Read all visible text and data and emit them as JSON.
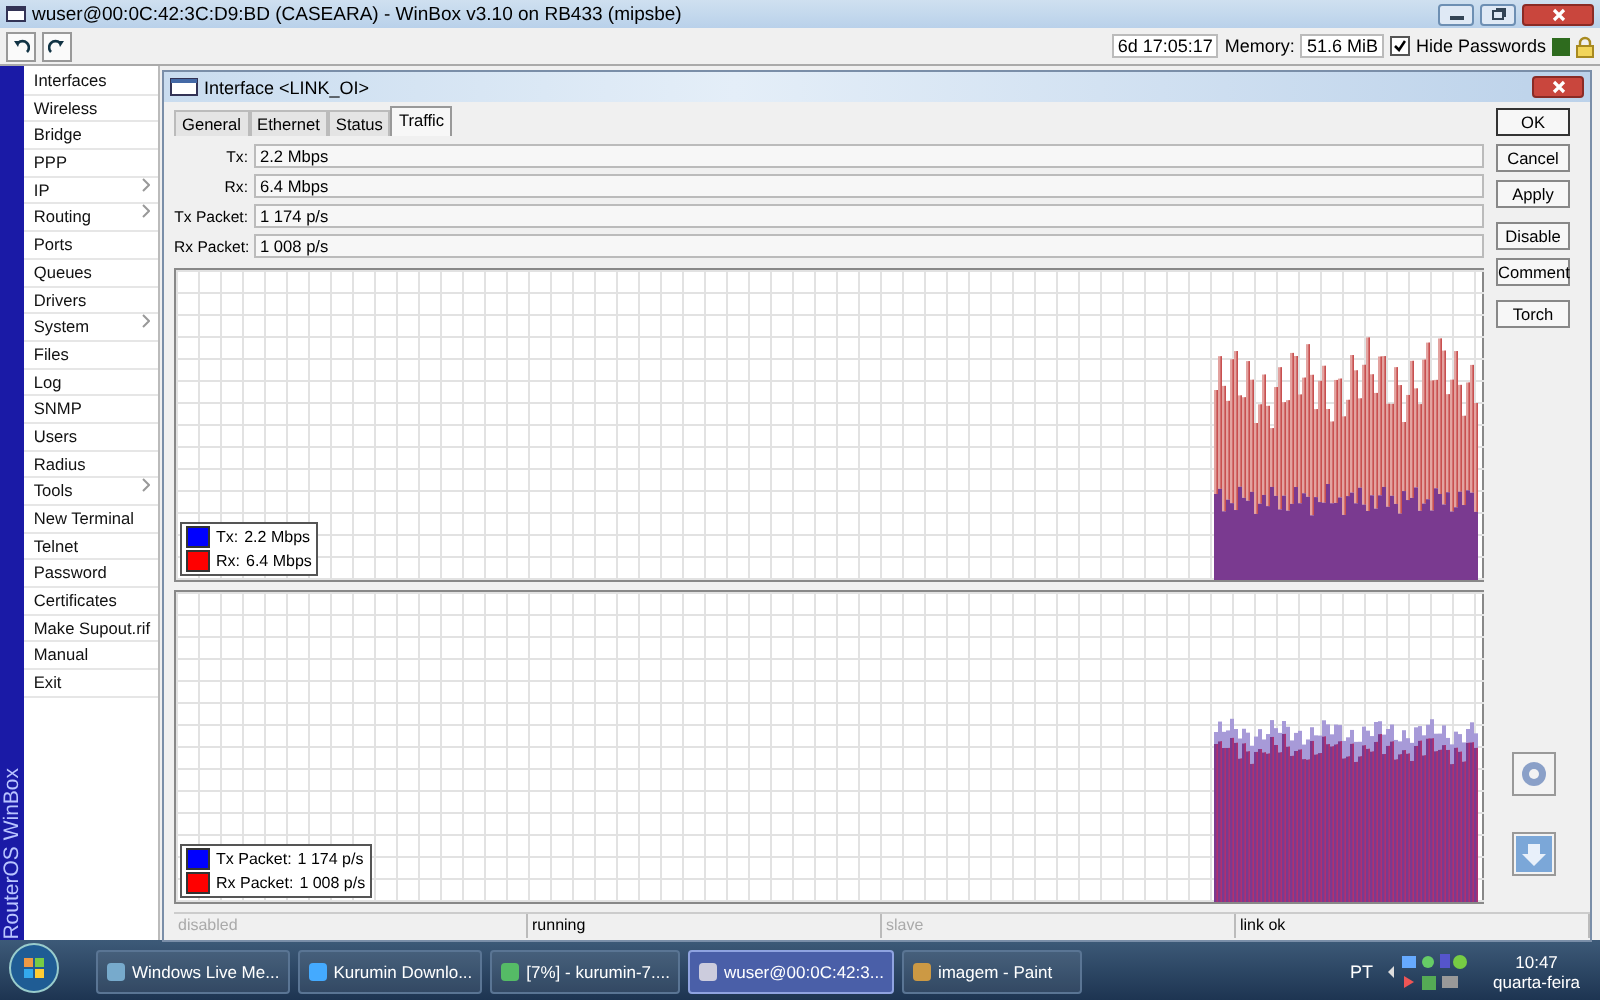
{
  "window": {
    "title": "wuser@00:0C:42:3C:D9:BD (CASEARA) - WinBox v3.10 on RB433 (mipsbe)"
  },
  "toolbar": {
    "uptime": "6d 17:05:17",
    "memory_label": "Memory:",
    "memory": "51.6 MiB",
    "hide_passwords": {
      "label": "Hide Passwords",
      "checked": true
    }
  },
  "sidebar": {
    "brand": "RouterOS WinBox",
    "items": [
      {
        "label": "Interfaces",
        "submenu": false
      },
      {
        "label": "Wireless",
        "submenu": false
      },
      {
        "label": "Bridge",
        "submenu": false
      },
      {
        "label": "PPP",
        "submenu": false
      },
      {
        "label": "IP",
        "submenu": true
      },
      {
        "label": "Routing",
        "submenu": true
      },
      {
        "label": "Ports",
        "submenu": false
      },
      {
        "label": "Queues",
        "submenu": false
      },
      {
        "label": "Drivers",
        "submenu": false
      },
      {
        "label": "System",
        "submenu": true
      },
      {
        "label": "Files",
        "submenu": false
      },
      {
        "label": "Log",
        "submenu": false
      },
      {
        "label": "SNMP",
        "submenu": false
      },
      {
        "label": "Users",
        "submenu": false
      },
      {
        "label": "Radius",
        "submenu": false
      },
      {
        "label": "Tools",
        "submenu": true
      },
      {
        "label": "New Terminal",
        "submenu": false
      },
      {
        "label": "Telnet",
        "submenu": false
      },
      {
        "label": "Password",
        "submenu": false
      },
      {
        "label": "Certificates",
        "submenu": false
      },
      {
        "label": "Make Supout.rif",
        "submenu": false
      },
      {
        "label": "Manual",
        "submenu": false
      },
      {
        "label": "Exit",
        "submenu": false
      }
    ]
  },
  "dialog": {
    "title": "Interface <LINK_OI>",
    "tabs": [
      {
        "label": "General",
        "selected": false
      },
      {
        "label": "Ethernet",
        "selected": false
      },
      {
        "label": "Status",
        "selected": false
      },
      {
        "label": "Traffic",
        "selected": true
      }
    ],
    "fields": [
      {
        "label": "Tx:",
        "value": "2.2 Mbps"
      },
      {
        "label": "Rx:",
        "value": "6.4 Mbps"
      },
      {
        "label": "Tx Packet:",
        "value": "1 174 p/s"
      },
      {
        "label": "Rx Packet:",
        "value": "1 008 p/s"
      }
    ],
    "graphs": [
      {
        "kind": "bits",
        "legend": [
          {
            "label": "Tx:",
            "value": "2.2 Mbps",
            "color": "#0000ff"
          },
          {
            "label": "Rx:",
            "value": "6.4 Mbps",
            "color": "#ff0000"
          }
        ]
      },
      {
        "kind": "packets",
        "legend": [
          {
            "label": "Tx Packet:",
            "value": "1 174 p/s",
            "color": "#0000ff"
          },
          {
            "label": "Rx Packet:",
            "value": "1 008 p/s",
            "color": "#ff0000"
          }
        ]
      }
    ],
    "buttons": [
      "OK",
      "Cancel",
      "Apply",
      "Disable",
      "Comment",
      "Torch"
    ],
    "status_bar": [
      {
        "text": "disabled",
        "disabled": true
      },
      {
        "text": "running",
        "disabled": false
      },
      {
        "text": "slave",
        "disabled": true
      },
      {
        "text": "link ok",
        "disabled": false
      }
    ]
  },
  "taskbar": {
    "tasks": [
      {
        "label": "Windows Live Me...",
        "selected": false
      },
      {
        "label": "Kurumin Downlo...",
        "selected": false
      },
      {
        "label": "[7%] - kurumin-7....",
        "selected": false
      },
      {
        "label": "wuser@00:0C:42:3...",
        "selected": true
      },
      {
        "label": "imagem - Paint",
        "selected": false
      }
    ],
    "language": "PT",
    "time": "10:47",
    "day": "quarta-feira"
  }
}
